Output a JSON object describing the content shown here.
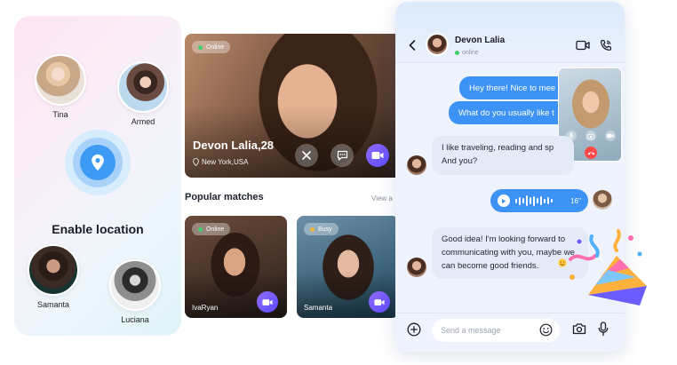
{
  "location_panel": {
    "users": [
      {
        "name": "Tina"
      },
      {
        "name": "Armed"
      },
      {
        "name": "Samanta"
      },
      {
        "name": "Luciana"
      }
    ],
    "enable_label": "Enable location"
  },
  "feed": {
    "hero": {
      "status": "Online",
      "name": "Devon Lalia,28",
      "location": "New York,USA"
    },
    "popular_title": "Popular matches",
    "view_all": "View a",
    "cards": [
      {
        "status": "Online",
        "name": "IvaRyan"
      },
      {
        "status": "Busy",
        "name": "Samanta"
      }
    ]
  },
  "chat": {
    "contact_name": "Devon Lalia",
    "contact_status": "online",
    "messages": [
      {
        "from": "me",
        "text": "Hey there! Nice to mee"
      },
      {
        "from": "me",
        "text": "What do you usually like t"
      },
      {
        "from": "them",
        "text": "I like traveling, reading and sp And you?"
      },
      {
        "from": "me",
        "type": "voice",
        "duration": "16''"
      },
      {
        "from": "them",
        "text": "Good idea! I'm looking forward to communicating with you, maybe we can become good friends."
      }
    ],
    "input_placeholder": "Send a message"
  },
  "colors": {
    "accent_blue": "#3d93f5",
    "video_purple": "#6a55ff",
    "online_green": "#3ed06a",
    "busy_orange": "#f2b43a",
    "end_call_red": "#ff4a4a"
  }
}
